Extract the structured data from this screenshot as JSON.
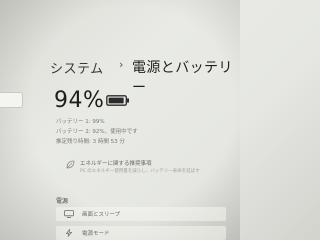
{
  "breadcrumb": {
    "parent": "システム",
    "separator": "›",
    "current": "電源とバッテリー"
  },
  "battery": {
    "percent_text": "94%",
    "level": 0.94,
    "details": [
      "バッテリー 1: 99%",
      "バッテリー 2: 92%、使用中です",
      "推定残り時間: 3 時間 53 分"
    ]
  },
  "tip": {
    "title": "エネルギーに関する推奨事項",
    "subtitle": "PC のエネルギー使用量を減らし、バッテリー寿命を延ばす"
  },
  "power_section": {
    "heading": "電源",
    "items": [
      {
        "label": "画面とスリープ",
        "icon": "monitor-icon"
      },
      {
        "label": "電源モード",
        "icon": "lightning-icon"
      }
    ]
  },
  "colors": {
    "background": "#e6e7e2",
    "text": "#1e1e1e",
    "muted": "#7a7a78"
  }
}
